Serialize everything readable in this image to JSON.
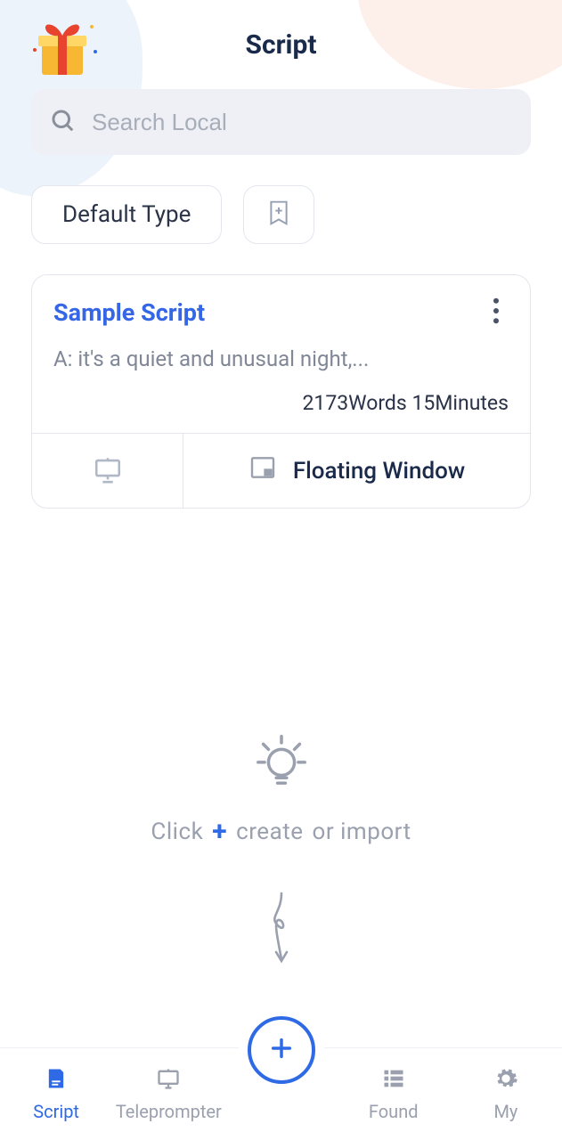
{
  "header": {
    "title": "Script"
  },
  "search": {
    "placeholder": "Search Local"
  },
  "filters": {
    "default_label": "Default Type",
    "bookmark_icon": "bookmark-add-icon"
  },
  "scripts": [
    {
      "title": "Sample Script",
      "preview": "A: it's a quiet and unusual night,...",
      "words_label": "2173Words",
      "minutes_label": "15Minutes",
      "action_presentation_icon": "presentation-icon",
      "action_floating_label": "Floating Window"
    }
  ],
  "hint": {
    "prefix": "Click",
    "plus": "+",
    "create": "create",
    "suffix": "or import",
    "bulb_icon": "lightbulb-icon",
    "arrow_icon": "curly-arrow-down-icon"
  },
  "tabs": {
    "script": "Script",
    "teleprompter": "Teleprompter",
    "found": "Found",
    "my": "My",
    "add_icon": "plus-icon"
  },
  "gift_icon": "gift-icon",
  "colors": {
    "accent": "#2e6ae6",
    "text_dark": "#1a2a4a",
    "text_muted": "#9aa0ae",
    "bg_search": "#eef0f5"
  }
}
